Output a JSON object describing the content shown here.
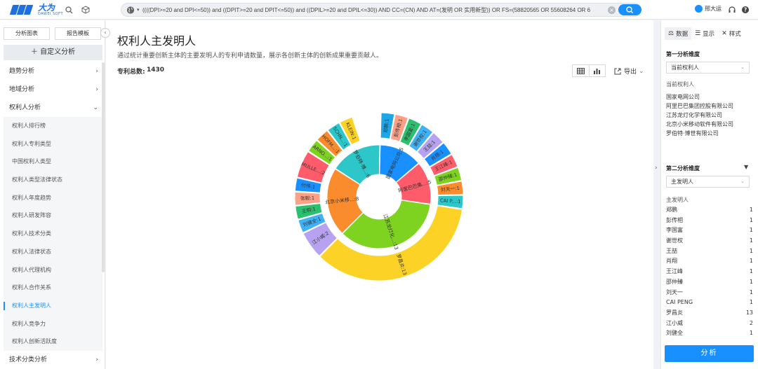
{
  "app": {
    "logo_cn": "大为",
    "logo_en": "DAWEI SOFT"
  },
  "search": {
    "query": "((((DPI>=20 and DPI<=50)) and ((DPIT>=20 and DPIT<=50)) and ((DPIL>=20 and DPIL<=30)) AND CC=(CN) AND AT=(发明 OR 实用新型)) OR FS=(58820565 OR 55608264 OR 6"
  },
  "user": {
    "name": "邢大运"
  },
  "left": {
    "tabs": [
      "分析图表",
      "报告模板"
    ],
    "add_label": "自定义分析",
    "groups": [
      {
        "label": "趋势分析",
        "open": false
      },
      {
        "label": "地域分析",
        "open": false
      },
      {
        "label": "权利人分析",
        "open": true
      }
    ],
    "subitems": [
      "权利人排行榜",
      "权利人专利类型",
      "中国权利人类型",
      "权利人类型法律状态",
      "权利人年度趋势",
      "权利人研发阵容",
      "权利人技术分类",
      "权利人法律状态",
      "权利人代理机构",
      "权利人合作关系",
      "权利人主发明人",
      "权利人竞争力",
      "权利人创新活跃度"
    ],
    "active_sub": "权利人主发明人",
    "last_group": "技术分类分析"
  },
  "main": {
    "title": "权利人主发明人",
    "desc": "通过统计重要创新主体的主要发明人的专利申请数量，展示各创新主体的创新成果重要贡献人。",
    "total_label": "专利总数:",
    "total_value": "1430",
    "export_label": "导出"
  },
  "right": {
    "tabs": [
      "数据",
      "显示",
      "样式"
    ],
    "dim1_title": "第一分析维度",
    "dim1_value": "当前权利人",
    "dim1_list_title": "当前权利人",
    "dim1_list": [
      "国家电网公司",
      "阿里巴巴集团控股有限公司",
      "江苏龙灯化学有限公司",
      "北京小米移动软件有限公司",
      "罗伯特·博世有限公司"
    ],
    "dim2_title": "第二分析维度",
    "dim2_value": "主发明人",
    "dim2_list_title": "主发明人",
    "inventors": [
      {
        "name": "郑鹏",
        "count": "1"
      },
      {
        "name": "彭传相",
        "count": "1"
      },
      {
        "name": "李国富",
        "count": "1"
      },
      {
        "name": "谢世权",
        "count": "1"
      },
      {
        "name": "王喆",
        "count": "1"
      },
      {
        "name": "肖翔",
        "count": "1"
      },
      {
        "name": "王江峰",
        "count": "1"
      },
      {
        "name": "邵仲臻",
        "count": "1"
      },
      {
        "name": "刘天一",
        "count": "1"
      },
      {
        "name": "CAI PENG",
        "count": "1"
      },
      {
        "name": "罗昌炎",
        "count": "13"
      },
      {
        "name": "江小威",
        "count": "2"
      },
      {
        "name": "刘健全",
        "count": "1"
      }
    ],
    "analyze_label": "分析"
  },
  "chart_data": {
    "type": "sunburst",
    "inner": [
      {
        "label": "国家电网公司",
        "short": "国家电网公司:5",
        "value": 5,
        "color": "#1890ff"
      },
      {
        "label": "阿里巴巴集团控股有限公司",
        "short": "阿里巴巴集...:5",
        "value": 5,
        "color": "#ff5c6b"
      },
      {
        "label": "江苏龙灯化学有限公司",
        "short": "江苏龙灯化...:13",
        "value": 13,
        "color": "#7ed321"
      },
      {
        "label": "北京小米移动软件有限公司",
        "short": "北京小米移...:8",
        "value": 8,
        "color": "#fa8c2e"
      },
      {
        "label": "罗伯特·博世有限公司",
        "short": "罗伯特·博...:6",
        "value": 6,
        "color": "#2ec7c9"
      }
    ],
    "outer": [
      {
        "label": "郑鹏:1",
        "value": 1,
        "color": "#1ea7e6",
        "parent": 0
      },
      {
        "label": "彭传相:1",
        "value": 1,
        "color": "#fda086",
        "parent": 0
      },
      {
        "label": "李国富:1",
        "value": 1,
        "color": "#2cbf6e",
        "parent": 0
      },
      {
        "label": "谢世权:1",
        "value": 1,
        "color": "#41b1f5",
        "parent": 0
      },
      {
        "label": "王喆:1",
        "value": 1,
        "color": "#b6a2f0",
        "parent": 0
      },
      {
        "label": "肖翔:1",
        "value": 1,
        "color": "#1890ff",
        "parent": 1
      },
      {
        "label": "王江峰:1",
        "value": 1,
        "color": "#ff5c6b",
        "parent": 1
      },
      {
        "label": "邵仲臻:1",
        "value": 1,
        "color": "#7ed321",
        "parent": 1
      },
      {
        "label": "刘天一:1",
        "value": 1,
        "color": "#fa8c2e",
        "parent": 1
      },
      {
        "label": "CAI P...:1",
        "value": 1,
        "color": "#2ec7c9",
        "parent": 1
      },
      {
        "label": "罗昌炎:13",
        "value": 13,
        "color": "#fcd227",
        "parent": 2
      },
      {
        "label": "江小威:2",
        "value": 2,
        "color": "#b6a2f0",
        "parent": 3
      },
      {
        "label": "刘健全:1",
        "value": 1,
        "color": "#41b1f5",
        "parent": 3
      },
      {
        "label": "王明:1",
        "value": 1,
        "color": "#2cbf6e",
        "parent": 3
      },
      {
        "label": "张毅:1",
        "value": 1,
        "color": "#fda086",
        "parent": 3
      },
      {
        "label": "付伟:1",
        "value": 1,
        "color": "#1890ff",
        "parent": 3
      },
      {
        "label": "MULLE...:2",
        "value": 2,
        "color": "#ff5c6b",
        "parent": 4
      },
      {
        "label": "ARNO...:1",
        "value": 1,
        "color": "#7ed321",
        "parent": 4
      },
      {
        "label": "HOFM...:1",
        "value": 1,
        "color": "#fa8c2e",
        "parent": 4
      },
      {
        "label": "SCHN...:1",
        "value": 1,
        "color": "#2ec7c9",
        "parent": 4
      },
      {
        "label": "KLEIN:1",
        "value": 1,
        "color": "#fcd227",
        "parent": 4
      }
    ]
  }
}
